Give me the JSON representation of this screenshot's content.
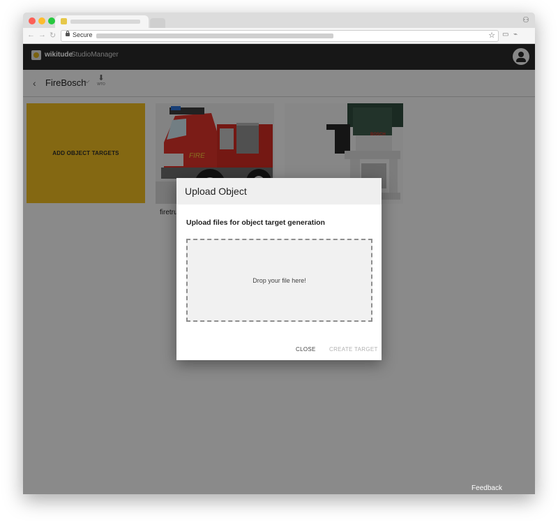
{
  "browser": {
    "address": {
      "secure_label": "Secure"
    }
  },
  "app": {
    "brand": "wikitude",
    "brand_sub": "StudioManager"
  },
  "project": {
    "name": "FireBosch",
    "download_label": "WTO"
  },
  "cards": {
    "add_label": "ADD OBJECT TARGETS",
    "items": [
      {
        "label": "firetru"
      },
      {
        "label": ""
      }
    ]
  },
  "modal": {
    "title": "Upload Object",
    "subtitle": "Upload files for object target generation",
    "dropzone_text": "Drop your file here!",
    "close_label": "CLOSE",
    "create_label": "CREATE TARGET"
  },
  "feedback_label": "Feedback",
  "colors": {
    "accent": "#e8b820",
    "appbar": "#2a2a2a",
    "fire_truck_red": "#d8322a",
    "drill_green": "#2f4a3c"
  },
  "icons": [
    "back-arrow-icon",
    "chevron-down-icon",
    "download-icon",
    "user-avatar-icon",
    "lock-icon",
    "star-icon",
    "cast-icon"
  ]
}
